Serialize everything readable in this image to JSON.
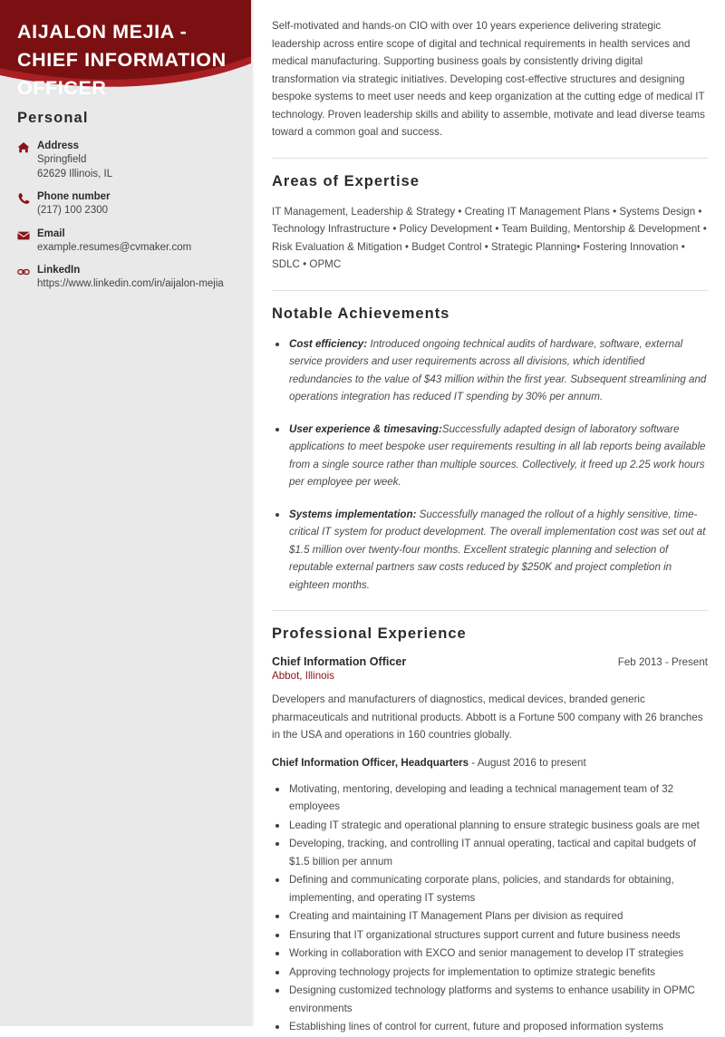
{
  "theme": {
    "header_dark": "#7a1012",
    "header_accent": "#a81f24",
    "sidebar_bg": "#e9e9e9",
    "icon_color": "#8b1418",
    "company_color": "#8b1418"
  },
  "header": {
    "name_title": "AIJALON MEJIA - CHIEF INFORMATION OFFICER"
  },
  "sidebar": {
    "heading": "Personal",
    "contacts": [
      {
        "icon": "home-icon",
        "label": "Address",
        "lines": [
          "Springfield",
          "62629 Illinois, IL"
        ]
      },
      {
        "icon": "phone-icon",
        "label": "Phone number",
        "lines": [
          "(217) 100 2300"
        ]
      },
      {
        "icon": "envelope-icon",
        "label": "Email",
        "lines": [
          "example.resumes@cvmaker.com"
        ]
      },
      {
        "icon": "link-icon",
        "label": "LinkedIn",
        "lines": [
          "https://www.linkedin.com/in/aijalon-mejia"
        ]
      }
    ]
  },
  "main": {
    "intro": "Self-motivated and hands-on CIO with over 10 years experience delivering strategic leadership across entire scope of digital and technical requirements in health services and medical manufacturing. Supporting business goals by consistently driving digital transformation via strategic initiatives. Developing cost-effective structures and designing bespoke systems to meet user needs and keep organization at the cutting edge of medical IT technology. Proven leadership skills and ability to assemble, motivate and lead diverse teams toward a common goal and success.",
    "expertise": {
      "title": "Areas of Expertise",
      "text": "IT Management, Leadership & Strategy • Creating IT Management Plans • Systems Design • Technology Infrastructure • Policy Development • Team Building, Mentorship & Development • Risk Evaluation & Mitigation • Budget Control • Strategic Planning• Fostering Innovation • SDLC • OPMC"
    },
    "achievements": {
      "title": "Notable Achievements",
      "items": [
        {
          "lead": "Cost efficiency:",
          "text": " Introduced ongoing technical audits of hardware, software, external service providers and user requirements across all divisions, which identified redundancies to the value of $43 million within the first year. Subsequent streamlining and operations integration has reduced IT spending by 30% per annum."
        },
        {
          "lead": "User experience & timesaving:",
          "text": "Successfully adapted design of laboratory software applications to meet bespoke user requirements resulting in all lab reports being available from a single source rather than multiple sources. Collectively, it freed up 2.25 work hours per employee per week."
        },
        {
          "lead": "Systems implementation:",
          "text": " Successfully managed the rollout of a highly sensitive, time-critical IT system for product development. The overall implementation cost was set out at $1.5 million over twenty-four months. Excellent strategic planning and selection of reputable external partners saw costs reduced by $250K and project completion in eighteen months."
        }
      ]
    },
    "experience": {
      "title": "Professional Experience",
      "job": {
        "title": "Chief Information Officer",
        "date": "Feb 2013 - Present",
        "company": "Abbot, Illinois",
        "description": "Developers and manufacturers of diagnostics, medical devices, branded generic pharmaceuticals and nutritional products. Abbott is a Fortune 500 company with 26 branches in the USA and operations in 160 countries globally.",
        "role_bold": "Chief Information Officer, Headquarters",
        "role_rest": " - August 2016 to present",
        "duties": [
          "Motivating, mentoring, developing and leading a technical management team of 32 employees",
          "Leading IT strategic and operational planning to ensure strategic business goals are met",
          "Developing, tracking, and controlling IT annual operating, tactical and capital budgets of $1.5 billion per annum",
          "Defining and communicating corporate plans, policies, and standards for obtaining, implementing, and operating IT systems",
          "Creating and maintaining IT Management Plans per division as required",
          "Ensuring that IT organizational structures support current and future business needs",
          "Working in collaboration with EXCO and senior management to develop IT strategies",
          "Approving technology projects for implementation to optimize strategic benefits",
          "Designing customized technology platforms and systems to enhance usability in OPMC environments",
          "Establishing lines of control for current, future and proposed information systems"
        ]
      }
    }
  }
}
